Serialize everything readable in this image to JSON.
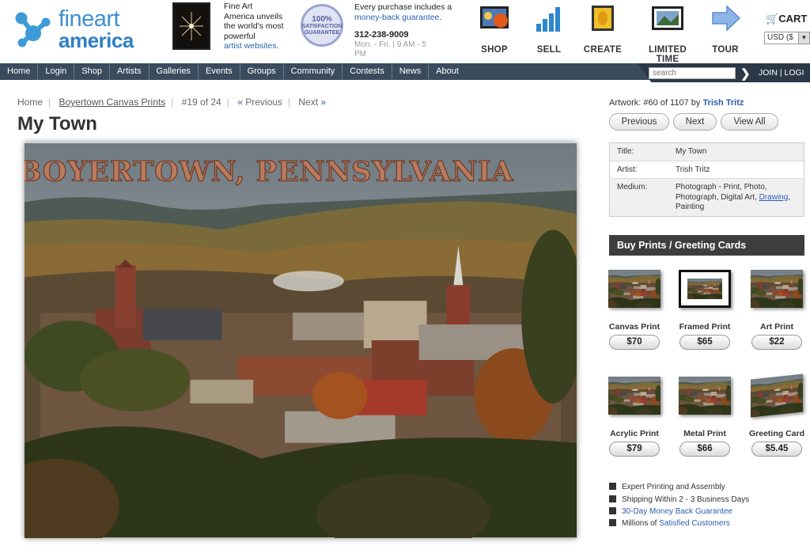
{
  "header": {
    "logo_line1": "fineart",
    "logo_line2": "america",
    "promo_lines": [
      "Fine Art",
      "America unveils",
      "the world's most",
      "powerful"
    ],
    "promo_link": "artist websites",
    "promo_period": ".",
    "seal_text": [
      "100%",
      "SATISFACTION",
      "GUARANTEE"
    ],
    "guarantee_line": "Every purchase includes a",
    "guarantee_link": "money-back guarantee",
    "guarantee_period": ".",
    "phone": "312-238-9009",
    "hours_line1": "Mon. - Fri.   |   9 AM - 5",
    "hours_line2": "PM",
    "nav_icons": [
      {
        "label": "SHOP",
        "icon": "shop-icon"
      },
      {
        "label": "SELL",
        "icon": "sell-chart-icon"
      },
      {
        "label": "CREATE",
        "icon": "create-icon"
      },
      {
        "label": "LIMITED TIME",
        "icon": "limited-time-icon"
      },
      {
        "label": "TOUR",
        "icon": "tour-arrow-icon"
      }
    ],
    "cart_label": "CART",
    "currency_value": "USD ($"
  },
  "navbar": {
    "links": [
      "Home",
      "Login",
      "Shop",
      "Artists",
      "Galleries",
      "Events",
      "Groups",
      "Community",
      "Contests",
      "News",
      "About"
    ],
    "search_placeholder": "search",
    "join_label": "JOIN  |  LOGI"
  },
  "breadcrumb": {
    "home": "Home",
    "section": "Boyertown Canvas Prints",
    "position": "#19 of 24",
    "previous": "Previous",
    "next": "Next"
  },
  "artwork": {
    "title": "My Town",
    "image_caption": "BOYERTOWN, PENNSYLVANIA"
  },
  "sidebar": {
    "artwork_label": "Artwork: #60 of 1107 by",
    "artist_link": "Trish Tritz",
    "buttons": {
      "previous": "Previous",
      "next": "Next",
      "view_all": "View All"
    },
    "info": {
      "title_key": "Title:",
      "title_val": "My Town",
      "artist_key": "Artist:",
      "artist_val": "Trish Tritz",
      "medium_key": "Medium:",
      "medium_val1": "Photograph - Print, Photo,",
      "medium_val2": "Photograph, Digital Art,",
      "medium_link": "Drawing",
      "medium_comma": ",",
      "medium_val3": "Painting"
    },
    "buy_header": "Buy Prints / Greeting Cards",
    "products": [
      {
        "name": "Canvas Print",
        "price": "$70"
      },
      {
        "name": "Framed Print",
        "price": "$65"
      },
      {
        "name": "Art Print",
        "price": "$22"
      },
      {
        "name": "Acrylic Print",
        "price": "$79"
      },
      {
        "name": "Metal Print",
        "price": "$66"
      },
      {
        "name": "Greeting Card",
        "price": "$5.45"
      }
    ],
    "bullets": {
      "b1": "Expert Printing and Assembly",
      "b2": "Shipping Within 2 - 3 Business Days",
      "b3": "30-Day Money Back Guarantee",
      "b4_text": "Millions of",
      "b4_link": "Satisfied Customers"
    }
  }
}
